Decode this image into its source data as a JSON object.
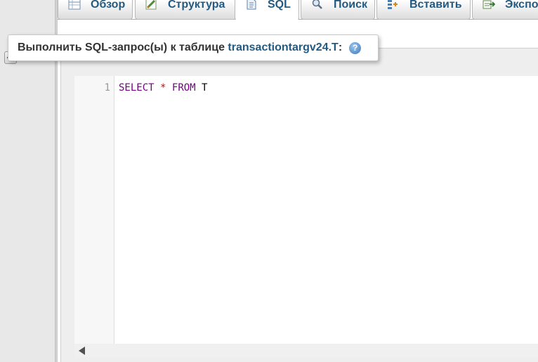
{
  "tabs": [
    {
      "label": "Обзор",
      "icon": "table-browse-icon",
      "active": false
    },
    {
      "label": "Структура",
      "icon": "structure-icon",
      "active": false
    },
    {
      "label": "SQL",
      "icon": "sql-icon",
      "active": true
    },
    {
      "label": "Поиск",
      "icon": "search-icon",
      "active": false
    },
    {
      "label": "Вставить",
      "icon": "insert-icon",
      "active": false
    },
    {
      "label": "Экспо",
      "icon": "export-icon",
      "active": false
    }
  ],
  "sql_panel": {
    "legend_prefix": "Выполнить SQL-запрос(ы) к таблице ",
    "table_name": "transactiontargv24.T",
    "legend_suffix": ":",
    "help_icon": "help-icon"
  },
  "editor": {
    "line_number": "1",
    "code": {
      "select": "SELECT",
      "star": "*",
      "from": "FROM",
      "table": "T"
    }
  },
  "colors": {
    "link": "#235a81",
    "keyword": "#770088",
    "operator": "#981a1a"
  }
}
